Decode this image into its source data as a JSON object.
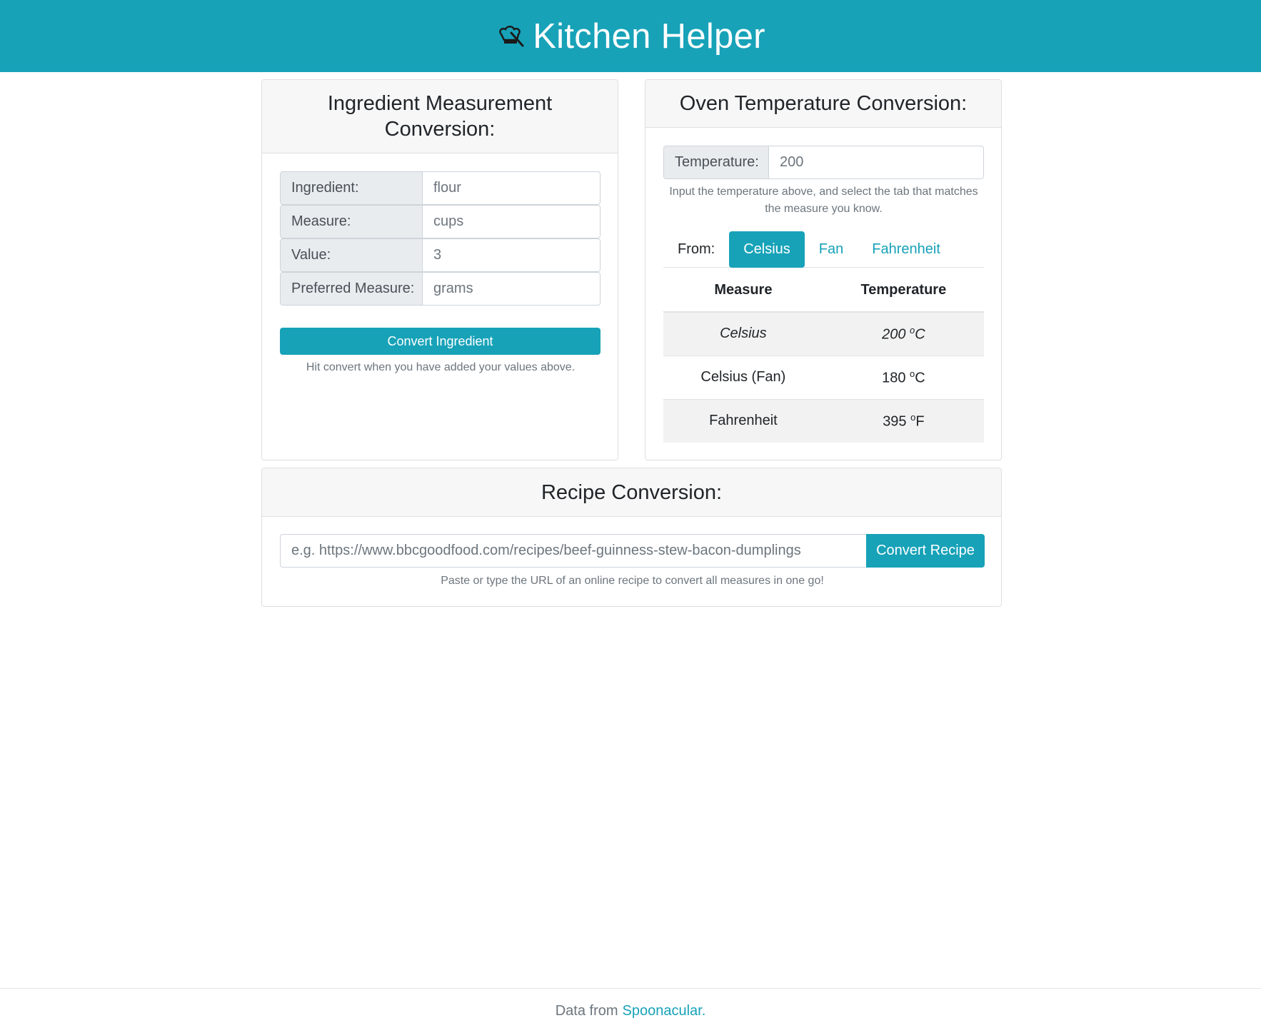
{
  "header": {
    "title": "Kitchen Helper",
    "logo_icon": "chef-hat-icon"
  },
  "ingredient_card": {
    "title": "Ingredient Measurement Conversion:",
    "rows": [
      {
        "label": "Ingredient:",
        "value": "flour"
      },
      {
        "label": "Measure:",
        "value": "cups"
      },
      {
        "label": "Value:",
        "value": "3"
      },
      {
        "label": "Preferred Measure:",
        "value": "grams"
      }
    ],
    "button": "Convert Ingredient",
    "help": "Hit convert when you have added your values above."
  },
  "oven_card": {
    "title": "Oven Temperature Conversion:",
    "temp_label": "Temperature:",
    "temp_value": "200",
    "help": "Input the temperature above, and select the tab that matches the measure you know.",
    "from_label": "From:",
    "tabs": [
      "Celsius",
      "Fan",
      "Fahrenheit"
    ],
    "active_tab": "Celsius",
    "table": {
      "headers": [
        "Measure",
        "Temperature"
      ],
      "rows": [
        {
          "measure": "Celsius",
          "value": "200",
          "unit": "C"
        },
        {
          "measure": "Celsius (Fan)",
          "value": "180",
          "unit": "C"
        },
        {
          "measure": "Fahrenheit",
          "value": "395",
          "unit": "F"
        }
      ],
      "degree_symbol": "o"
    }
  },
  "recipe_card": {
    "title": "Recipe Conversion:",
    "placeholder": "e.g. https://www.bbcgoodfood.com/recipes/beef-guinness-stew-bacon-dumplings",
    "button": "Convert Recipe",
    "help": "Paste or type the URL of an online recipe to convert all measures in one go!"
  },
  "footer": {
    "prefix": "Data from",
    "link": "Spoonacular."
  },
  "colors": {
    "accent": "#17a2b8",
    "header_bg": "#f7f7f7",
    "stripe": "#f2f2f2"
  }
}
